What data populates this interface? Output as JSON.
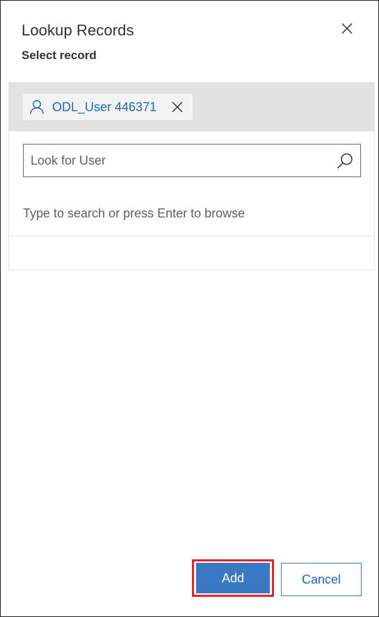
{
  "dialog": {
    "title": "Lookup Records",
    "subtitle": "Select record",
    "close_icon": "close-icon"
  },
  "selected": {
    "items": [
      {
        "label": "ODL_User 446371",
        "icon": "user-icon",
        "remove_icon": "close-icon"
      }
    ]
  },
  "search": {
    "placeholder": "Look for User",
    "value": "",
    "icon": "search-icon"
  },
  "hint": "Type to search or press Enter to browse",
  "footer": {
    "add_label": "Add",
    "cancel_label": "Cancel"
  },
  "colors": {
    "accent": "#3b78c2",
    "link": "#2266b5",
    "highlight": "#e8212b",
    "selected_bar": "#e1e1e1"
  }
}
